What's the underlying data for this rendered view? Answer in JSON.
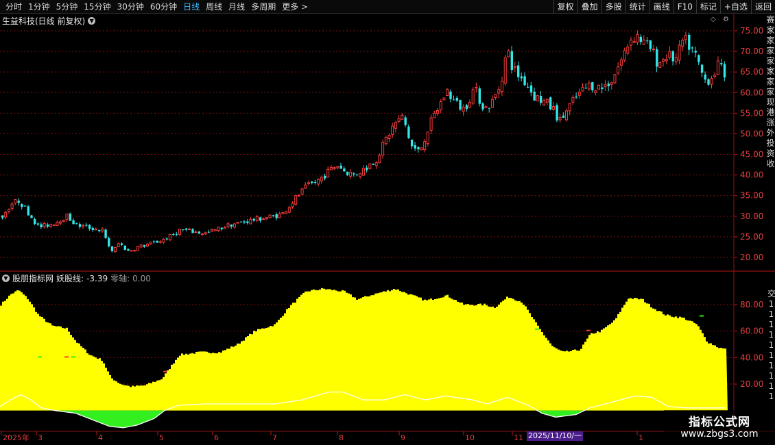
{
  "toolbar": {
    "periods": [
      "分时",
      "1分钟",
      "5分钟",
      "15分钟",
      "30分钟",
      "60分钟",
      "日线",
      "周线",
      "月线",
      "多周期",
      "更多 >"
    ],
    "active_period": "日线",
    "tools": [
      "复权",
      "叠加",
      "多股",
      "统计",
      "画线",
      "F10",
      "标记",
      "+自选",
      "返回"
    ]
  },
  "main_panel": {
    "title": "生益科技(日线 前复权)",
    "price_axis_labels": [
      "75.00",
      "70.00",
      "65.00",
      "60.00",
      "55.00",
      "50.00",
      "45.00",
      "40.00",
      "35.00",
      "30.00",
      "25.00",
      "20.00"
    ],
    "right_strip_text": "赛家家家家家家家现港涨外投资收"
  },
  "indicator_panel": {
    "name": "股朋指标网",
    "line_label": "妖股线:",
    "line_value": "-3.39",
    "zero_label": "零轴:",
    "zero_value": "0.00",
    "axis_labels": [
      "80.00",
      "60.00",
      "40.00",
      "20.00"
    ],
    "right_strip_text": "交1111111111"
  },
  "time_axis": {
    "labels": [
      "2025年",
      "3",
      "4",
      "5",
      "6",
      "7",
      "8",
      "9",
      "10",
      "11",
      "1"
    ],
    "highlight_date": "2025/11/10/一"
  },
  "watermark": {
    "title": "指标公式网",
    "url": "www.zbgs3.com"
  },
  "colors": {
    "up": "#ff3c3c",
    "down": "#31e7e7",
    "grid": "#7a0f0f",
    "yellow_fill": "#ffff00",
    "green_fill": "#34ef1f",
    "white_line": "#ffffff",
    "active_tab": "#3fb6ff"
  },
  "chart_data": [
    {
      "type": "candlestick",
      "title": "生益科技(日线 前复权)",
      "ylim": [
        18,
        77
      ],
      "yticks": [
        75,
        70,
        65,
        60,
        55,
        50,
        45,
        40,
        35,
        30,
        25,
        20
      ],
      "x_labels": [
        "2025年",
        "3",
        "4",
        "5",
        "6",
        "7",
        "8",
        "9",
        "10",
        "11",
        "1"
      ],
      "close_path": [
        [
          0,
          29.5
        ],
        [
          15,
          33.0
        ],
        [
          26,
          33.8
        ],
        [
          40,
          30.8
        ],
        [
          55,
          27.3
        ],
        [
          75,
          28.2
        ],
        [
          96,
          30.0
        ],
        [
          110,
          27.8
        ],
        [
          130,
          27.2
        ],
        [
          148,
          26.5
        ],
        [
          154,
          23.6
        ],
        [
          163,
          21.3
        ],
        [
          172,
          23.5
        ],
        [
          185,
          21.5
        ],
        [
          200,
          22.5
        ],
        [
          215,
          23.2
        ],
        [
          232,
          24.0
        ],
        [
          248,
          25.2
        ],
        [
          262,
          26.8
        ],
        [
          280,
          26.2
        ],
        [
          300,
          25.8
        ],
        [
          318,
          27.0
        ],
        [
          335,
          28.0
        ],
        [
          352,
          28.5
        ],
        [
          370,
          29.2
        ],
        [
          390,
          29.8
        ],
        [
          410,
          30.5
        ],
        [
          430,
          34.5
        ],
        [
          445,
          37.0
        ],
        [
          465,
          39.0
        ],
        [
          480,
          41.2
        ],
        [
          490,
          42.5
        ],
        [
          500,
          41.0
        ],
        [
          515,
          40.0
        ],
        [
          530,
          41.5
        ],
        [
          548,
          44.0
        ],
        [
          562,
          49.0
        ],
        [
          574,
          52.5
        ],
        [
          586,
          54.0
        ],
        [
          598,
          47.0
        ],
        [
          610,
          45.5
        ],
        [
          622,
          51.0
        ],
        [
          635,
          55.5
        ],
        [
          650,
          60.5
        ],
        [
          662,
          57.5
        ],
        [
          675,
          56.0
        ],
        [
          690,
          61.0
        ],
        [
          705,
          56.0
        ],
        [
          718,
          58.0
        ],
        [
          728,
          62.0
        ],
        [
          738,
          70.5
        ],
        [
          745,
          66.5
        ],
        [
          755,
          64.0
        ],
        [
          765,
          62.5
        ],
        [
          778,
          59.0
        ],
        [
          790,
          58.0
        ],
        [
          805,
          56.0
        ],
        [
          815,
          53.0
        ],
        [
          830,
          57.0
        ],
        [
          845,
          60.0
        ],
        [
          860,
          62.0
        ],
        [
          875,
          61.0
        ],
        [
          890,
          63.0
        ],
        [
          905,
          68.0
        ],
        [
          917,
          73.0
        ],
        [
          927,
          74.0
        ],
        [
          937,
          72.0
        ],
        [
          948,
          70.5
        ],
        [
          958,
          67.0
        ],
        [
          970,
          69.0
        ],
        [
          985,
          68.0
        ],
        [
          995,
          73.0
        ],
        [
          1005,
          71.0
        ],
        [
          1015,
          68.0
        ],
        [
          1025,
          63.0
        ],
        [
          1035,
          63.5
        ],
        [
          1045,
          66.5
        ],
        [
          1055,
          64.5
        ]
      ]
    },
    {
      "type": "area",
      "title": "股朋指标网",
      "ylim": [
        -15,
        100
      ],
      "yticks": [
        80,
        60,
        40,
        20
      ],
      "series": [
        {
          "name": "",
          "values_path": [
            [
              0,
              80
            ],
            [
              15,
              88
            ],
            [
              26,
              91
            ],
            [
              40,
              84
            ],
            [
              55,
              72
            ],
            [
              75,
              64
            ],
            [
              96,
              62
            ],
            [
              110,
              52
            ],
            [
              130,
              42
            ],
            [
              148,
              38
            ],
            [
              160,
              25
            ],
            [
              175,
              20
            ],
            [
              190,
              18
            ],
            [
              210,
              19
            ],
            [
              235,
              24
            ],
            [
              260,
              42
            ],
            [
              290,
              44
            ],
            [
              320,
              44
            ],
            [
              345,
              50
            ],
            [
              370,
              60
            ],
            [
              400,
              65
            ],
            [
              420,
              78
            ],
            [
              445,
              90
            ],
            [
              470,
              92
            ],
            [
              500,
              90
            ],
            [
              520,
              84
            ],
            [
              545,
              88
            ],
            [
              575,
              92
            ],
            [
              595,
              88
            ],
            [
              620,
              83
            ],
            [
              650,
              87
            ],
            [
              675,
              80
            ],
            [
              705,
              80
            ],
            [
              720,
              78
            ],
            [
              740,
              86
            ],
            [
              760,
              82
            ],
            [
              785,
              62
            ],
            [
              805,
              48
            ],
            [
              820,
              44
            ],
            [
              845,
              46
            ],
            [
              860,
              58
            ],
            [
              875,
              60
            ],
            [
              895,
              68
            ],
            [
              915,
              85
            ],
            [
              935,
              84
            ],
            [
              950,
              78
            ],
            [
              970,
              72
            ],
            [
              995,
              70
            ],
            [
              1015,
              65
            ],
            [
              1030,
              52
            ],
            [
              1045,
              48
            ],
            [
              1058,
              46
            ]
          ]
        },
        {
          "name": "",
          "values_path": [
            [
              0,
              3
            ],
            [
              15,
              8
            ],
            [
              30,
              12
            ],
            [
              45,
              8
            ],
            [
              60,
              2
            ],
            [
              80,
              0
            ],
            [
              110,
              -2
            ],
            [
              140,
              -8
            ],
            [
              160,
              -12
            ],
            [
              180,
              -13
            ],
            [
              200,
              -11
            ],
            [
              225,
              -6
            ],
            [
              240,
              0
            ],
            [
              260,
              4
            ],
            [
              300,
              5
            ],
            [
              350,
              5
            ],
            [
              400,
              5
            ],
            [
              440,
              8
            ],
            [
              480,
              14
            ],
            [
              500,
              14
            ],
            [
              530,
              8
            ],
            [
              560,
              8
            ],
            [
              590,
              12
            ],
            [
              620,
              8
            ],
            [
              650,
              11
            ],
            [
              690,
              8
            ],
            [
              710,
              5
            ],
            [
              740,
              10
            ],
            [
              770,
              4
            ],
            [
              790,
              -2
            ],
            [
              810,
              -5
            ],
            [
              840,
              -3
            ],
            [
              860,
              2
            ],
            [
              890,
              6
            ],
            [
              925,
              11
            ],
            [
              950,
              10
            ],
            [
              975,
              3
            ],
            [
              1000,
              2
            ],
            [
              1040,
              2
            ],
            [
              1058,
              2
            ]
          ]
        }
      ]
    }
  ]
}
